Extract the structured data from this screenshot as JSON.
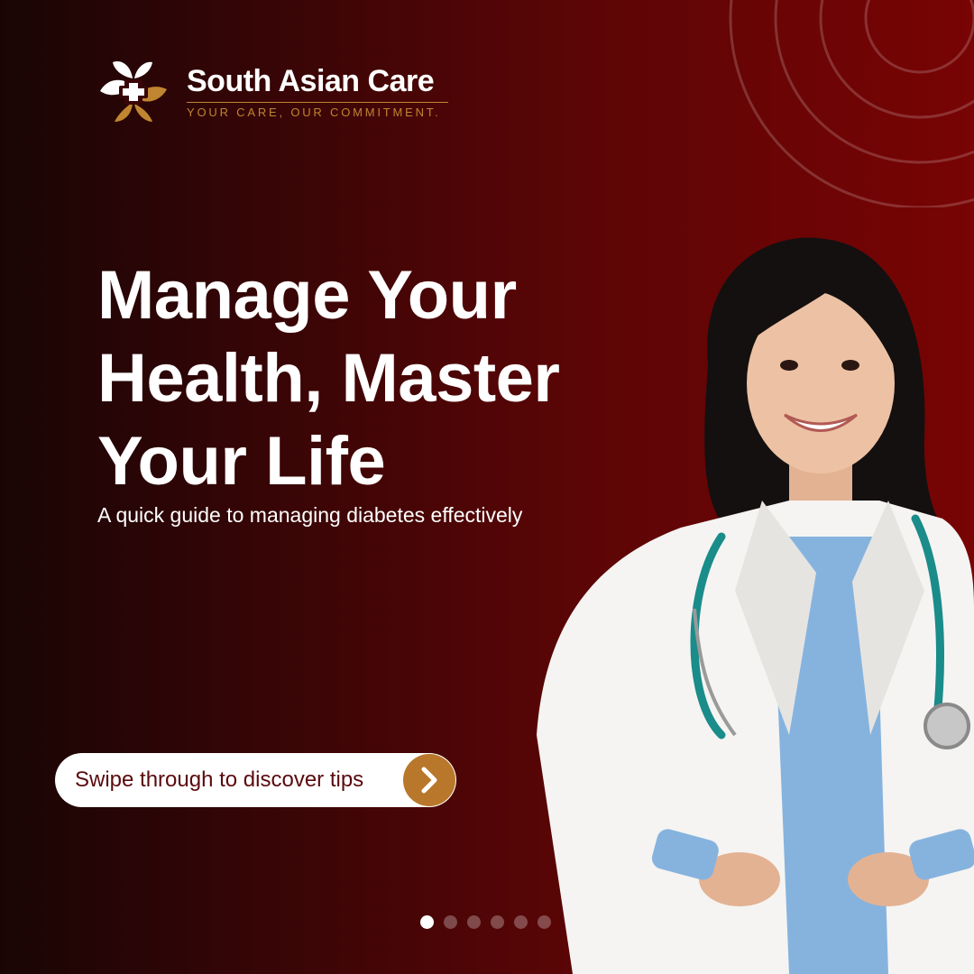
{
  "brand": {
    "name": "South Asian Care",
    "tagline": "YOUR CARE, OUR COMMITMENT."
  },
  "hero": {
    "headline_lines": [
      "Manage Your",
      "Health, Master",
      "Your Life"
    ],
    "subtitle": "A quick guide to managing diabetes effectively"
  },
  "cta": {
    "label": "Swipe through to discover tips",
    "icon": "chevron-right-icon"
  },
  "carousel": {
    "total": 6,
    "active_index": 0
  },
  "colors": {
    "background_dark": "#1a0505",
    "background_red": "#780404",
    "accent_gold": "#b8772b",
    "cta_text": "#5a0a0e",
    "text": "#ffffff"
  },
  "image": {
    "subject": "smiling-doctor-with-stethoscope"
  }
}
